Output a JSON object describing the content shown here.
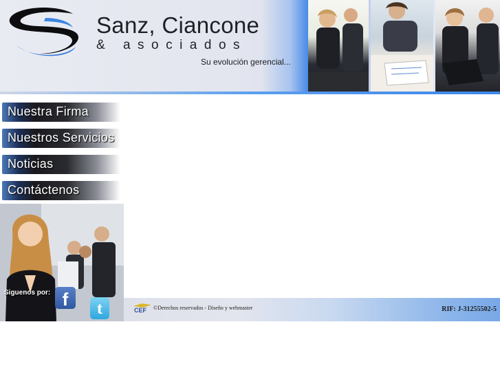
{
  "header": {
    "brand_name": "Sanz, Ciancone",
    "brand_sub": "& asociados",
    "tagline": "Su evolución gerencial..."
  },
  "menu": {
    "items": [
      {
        "label": "Nuestra Firma"
      },
      {
        "label": "Nuestros Servicios"
      },
      {
        "label": "Noticias"
      },
      {
        "label": "Contáctenos"
      }
    ]
  },
  "social": {
    "label": "Siguenos por:",
    "facebook_glyph": "f",
    "twitter_glyph": "t"
  },
  "footer": {
    "copyright": "©Derechos reservados - Diseño y webmaster",
    "rif": "RIF: J-31255502-5"
  },
  "icons": {
    "logo": "swoosh-logo",
    "facebook": "facebook-icon",
    "twitter": "twitter-icon",
    "footer_logo": "webmaster-logo"
  },
  "colors": {
    "accent_blue": "#3e86ea",
    "menu_dark": "#1a1a1e",
    "facebook": "#3b5998",
    "twitter": "#2fa7de"
  }
}
